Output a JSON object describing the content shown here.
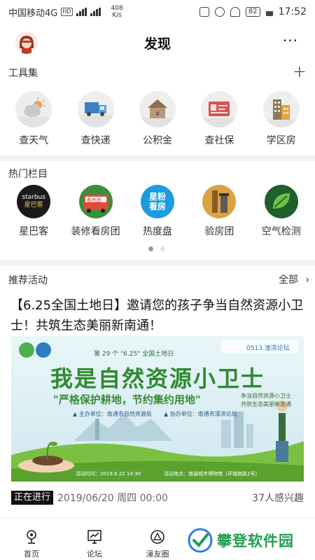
{
  "status_bar": {
    "carrier": "中国移动4G",
    "hd": "HD",
    "net_type": "4G",
    "speed_value": "408",
    "speed_unit": "K/s",
    "battery": "82",
    "time": "17:52"
  },
  "header": {
    "title": "发现",
    "more": "···"
  },
  "tools": {
    "section_title": "工具集",
    "add": "+",
    "items": [
      {
        "label": "查天气",
        "icon": "weather-icon"
      },
      {
        "label": "查快递",
        "icon": "delivery-truck-icon"
      },
      {
        "label": "公积金",
        "icon": "house-fund-icon"
      },
      {
        "label": "查社保",
        "icon": "social-security-card-icon"
      },
      {
        "label": "学区房",
        "icon": "school-district-building-icon"
      }
    ]
  },
  "hot": {
    "section_title": "热门栏目",
    "items": [
      {
        "label": "星巴客",
        "icon_text_top": "starbus",
        "icon_text_bottom": "星巴客",
        "icon": "starbus-logo-icon"
      },
      {
        "label": "装修看房团",
        "icon_text_top": "看房团",
        "icon": "bus-icon"
      },
      {
        "label": "热度盘",
        "icon_text_top": "星粉",
        "icon_text_bottom": "看房",
        "icon": "star-fans-icon"
      },
      {
        "label": "验房团",
        "icon": "inspection-tools-icon"
      },
      {
        "label": "空气检测",
        "icon": "air-leaf-icon"
      }
    ],
    "page_count": 2,
    "active_page": 1
  },
  "activities": {
    "section_title": "推荐活动",
    "all_link": "全部",
    "all_chevron": "›",
    "item": {
      "title": "【6.25全国土地日】邀请您的孩子争当自然资源小卫士！共筑生态美丽新南通！",
      "status": "正在进行",
      "date": "2019/06/20 周四 00:00",
      "interest": "37人感兴趣",
      "banner": {
        "subtitle": "第 29 个 \"6.25\" 全国土地日",
        "brand": "0513 濠滨论坛",
        "headline": "我是自然资源小卫士",
        "slogan": "\"严格保护耕地，节约集约用地\"",
        "side_text_1": "争当自然资源小卫士",
        "side_text_2": "共筑生态美丽新南通",
        "organizer": "▲ 主办单位：南通市自然资源局",
        "co_organizer": "▲ 协办单位：南通市濠滨论坛",
        "event_time": "活动时间：2019.6.22 14:30",
        "event_place": "活动地点：南通城市博物馆（环城南路1号）"
      }
    }
  },
  "bottom_nav": {
    "items": [
      {
        "label": "首页",
        "icon": "home-joystick-icon"
      },
      {
        "label": "论坛",
        "icon": "forum-chart-icon"
      },
      {
        "label": "濠友圈",
        "icon": "friends-circle-icon"
      }
    ]
  },
  "watermark": {
    "text": "攀登软件园"
  },
  "colors": {
    "accent_green": "#1d9e4f",
    "badge_bg": "#111111",
    "divider": "#f2f2f2"
  }
}
